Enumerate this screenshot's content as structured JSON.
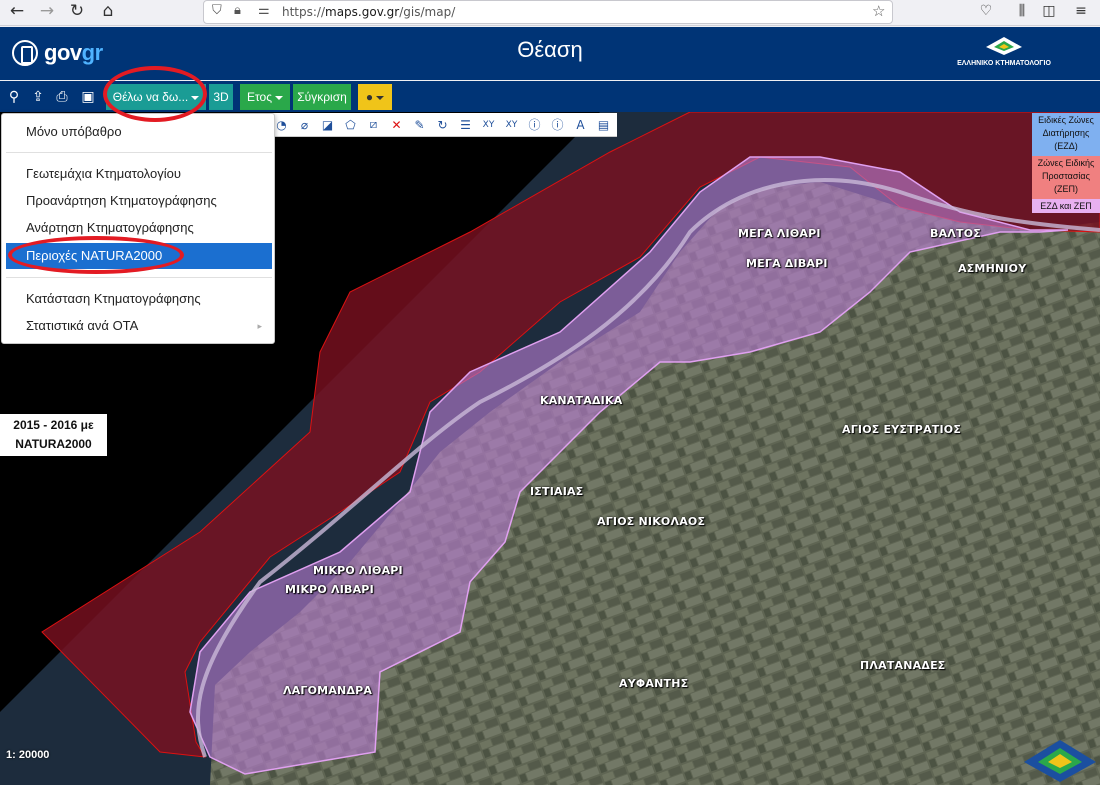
{
  "browser": {
    "url_prefix": "https://",
    "url_host": "maps.gov.gr",
    "url_path": "/gis/map/"
  },
  "header": {
    "logo_main": "gov",
    "logo_accent": "gr",
    "title": "Θέαση",
    "brand_name": "ΕΛΛΗΝΙΚΟ ΚΤΗΜΑΤΟΛΟΓΙΟ"
  },
  "toolbar": {
    "search_icon": "search-icon",
    "upload_icon": "file-upload-icon",
    "print_icon": "print-icon",
    "save_icon": "save-icon",
    "want_to_see_label": "Θέλω να δω...",
    "view_3d_label": "3D",
    "year_label": "Ετος",
    "compare_label": "Σύγκριση",
    "location_icon": "map-pin-icon"
  },
  "menu": {
    "items": [
      "Μόνο υπόβαθρο",
      "Γεωτεμάχια Κτηματολογίου",
      "Προανάρτηση Κτηματογράφησης",
      "Ανάρτηση Κτηματογράφησης",
      "Περιοχές NATURA2000",
      "Κατάσταση Κτηματογράφησης",
      "Στατιστικά ανά ΟΤΑ"
    ],
    "active_item": "Περιοχές NATURA2000",
    "submenu_arrow": "▸"
  },
  "legend": {
    "items": [
      {
        "label": "Ειδικές Ζώνες Διατήρησης (ΕΖΔ)",
        "color": "#7fb0f0"
      },
      {
        "label": "Ζώνες Ειδικής Προστασίας (ΖΕΠ)",
        "color": "#f08080"
      },
      {
        "label": "ΕΖΔ και ΖΕΠ",
        "color": "#e8b0f0"
      }
    ]
  },
  "info_box": {
    "line1": "2015 - 2016 με",
    "line2": "NATURA2000"
  },
  "scale": "1: 20000",
  "places": [
    "ΜΕΓΑ ΛΙΘΑΡΙ",
    "ΜΕΓΑ ΔΙΒΑΡΙ",
    "ΒΑΛΤΟΣ",
    "ΑΣΜΗΝΙΟΥ",
    "ΚΑΝΑΤΑΔΙΚΑ",
    "ΑΓΙΟΣ ΕΥΣΤΡΑΤΙΟΣ",
    "ΙΣΤΙΑΙΑΣ",
    "ΑΓΙΟΣ ΝΙΚΟΛΑΟΣ",
    "ΜΙΚΡΟ ΛΙΘΑΡΙ",
    "ΜΙΚΡΟ ΛΙΒΑΡΙ",
    "ΛΑΓΟΜΑΝΔΡΑ",
    "ΑΥΦΑΝΤΗΣ",
    "ΠΛΑΤΑΝΑΔΕΣ"
  ],
  "colors": {
    "header_bg": "#003476",
    "teal": "#1a9c95",
    "green": "#2aa84a",
    "yellow": "#f0c419",
    "menu_active": "#1b6fd0",
    "annotation": "#e31b23"
  }
}
